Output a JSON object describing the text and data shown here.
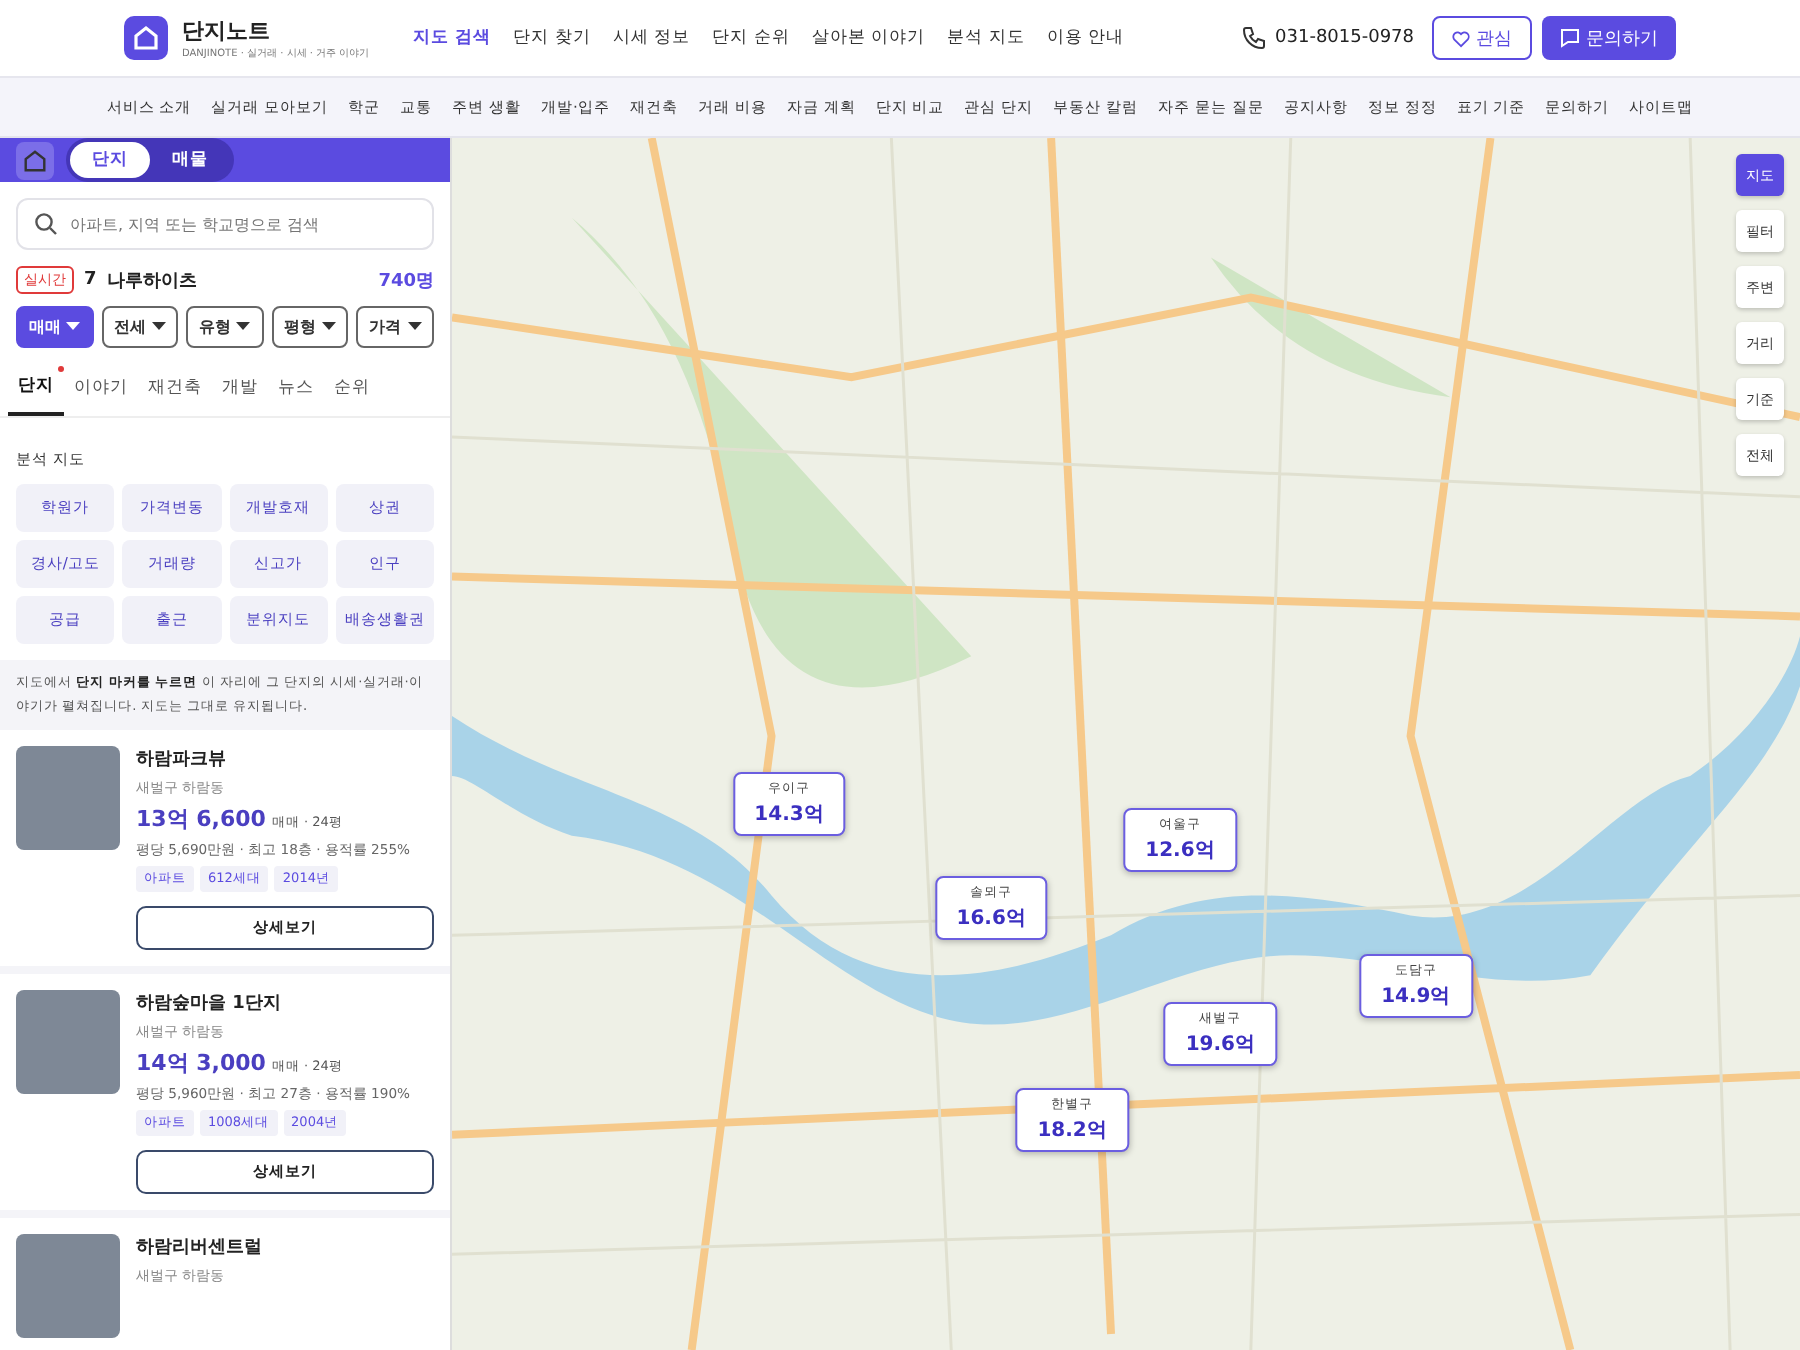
{
  "brand": {
    "name": "단지노트",
    "tagline": "DANJINOTE · 실거래 · 시세 · 거주 이야기"
  },
  "main_nav": [
    {
      "label": "지도 검색",
      "selected": true
    },
    {
      "label": "단지 찾기",
      "selected": false
    },
    {
      "label": "시세 정보",
      "selected": false
    },
    {
      "label": "단지 순위",
      "selected": false
    },
    {
      "label": "살아본 이야기",
      "selected": false
    },
    {
      "label": "분석 지도",
      "selected": false
    },
    {
      "label": "이용 안내",
      "selected": false
    }
  ],
  "phone": "031-8015-0978",
  "favorite_button": "관심",
  "inquiry_button": "문의하기",
  "sub_nav": [
    "서비스 소개",
    "실거래 모아보기",
    "학군",
    "교통",
    "주변 생활",
    "개발·입주",
    "재건축",
    "거래 비용",
    "자금 계획",
    "단지 비교",
    "관심 단지",
    "부동산 칼럼",
    "자주 묻는 질문",
    "공지사항",
    "정보 정정",
    "표기 기준",
    "문의하기",
    "사이트맵"
  ],
  "mode_toggle": [
    {
      "label": "단지",
      "selected": true
    },
    {
      "label": "매물",
      "selected": false
    }
  ],
  "search": {
    "placeholder": "아파트, 지역 또는 학교명으로 검색"
  },
  "trending": {
    "badge": "실시간",
    "rank": "7",
    "name": "나루하이츠",
    "count": "740명"
  },
  "filters": [
    {
      "label": "매매",
      "selected": true
    },
    {
      "label": "전세",
      "selected": false
    },
    {
      "label": "유형",
      "selected": false
    },
    {
      "label": "평형",
      "selected": false
    },
    {
      "label": "가격",
      "selected": false
    }
  ],
  "tabs": [
    {
      "label": "단지",
      "selected": true,
      "dot": true
    },
    {
      "label": "이야기",
      "selected": false,
      "dot": false
    },
    {
      "label": "재건축",
      "selected": false,
      "dot": false
    },
    {
      "label": "개발",
      "selected": false,
      "dot": false
    },
    {
      "label": "뉴스",
      "selected": false,
      "dot": false
    },
    {
      "label": "순위",
      "selected": false,
      "dot": false
    }
  ],
  "analysis": {
    "title": "분석 지도",
    "chips": [
      "학원가",
      "가격변동",
      "개발호재",
      "상권",
      "경사/고도",
      "거래량",
      "신고가",
      "인구",
      "공급",
      "출근",
      "분위지도",
      "배송생활권"
    ]
  },
  "hint": "지도에서 **단지 마커를 누르면** 이 자리에 그 단지의 시세·실거래·이야기가 펼쳐집니다. 지도는 그대로 유지됩니다.",
  "listings": [
    {
      "name": "하람파크뷰",
      "location": "새벌구 하람동",
      "price": "13억 6,600",
      "deal": "매매 · 24평",
      "details": "평당 5,690만원 · 최고 18층 · 용적률 255%",
      "tags": [
        "아파트",
        "612세대",
        "2014년"
      ],
      "button": "상세보기"
    },
    {
      "name": "하람숲마을 1단지",
      "location": "새벌구 하람동",
      "price": "14억 3,000",
      "deal": "매매 · 24평",
      "details": "평당 5,960만원 · 최고 27층 · 용적률 190%",
      "tags": [
        "아파트",
        "1008세대",
        "2004년"
      ],
      "button": "상세보기"
    },
    {
      "name": "하람리버센트럴",
      "location": "새벌구 하람동"
    }
  ],
  "map_markers": [
    {
      "district": "우이구",
      "price": "14.3억"
    },
    {
      "district": "여울구",
      "price": "12.6억"
    },
    {
      "district": "솔뫼구",
      "price": "16.6억"
    },
    {
      "district": "도담구",
      "price": "14.9억"
    },
    {
      "district": "새벌구",
      "price": "19.6억"
    },
    {
      "district": "한별구",
      "price": "18.2억"
    }
  ],
  "map_controls": [
    {
      "label": "지도",
      "selected": true
    },
    {
      "label": "필터",
      "selected": false
    },
    {
      "label": "주변",
      "selected": false
    },
    {
      "label": "거리",
      "selected": false
    },
    {
      "label": "기준",
      "selected": false
    },
    {
      "label": "전체",
      "selected": false
    }
  ]
}
